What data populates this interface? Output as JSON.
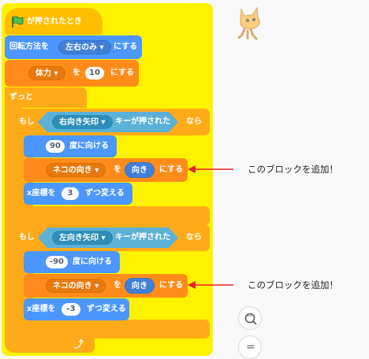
{
  "hat": {
    "label": "が押されたとき"
  },
  "rotation": {
    "prefix": "回転方法を",
    "value": "左右のみ",
    "suffix": "にする"
  },
  "health": {
    "var_name": "体力",
    "to": "を",
    "value": "10",
    "suffix": "にする"
  },
  "forever": {
    "label": "ずっと"
  },
  "if1": {
    "if_label": "もし",
    "key": "右向き矢印",
    "pressed": "キーが押された",
    "then_label": "なら",
    "point_value": "90",
    "point_suffix": "度に向ける",
    "set_var": "ネコの向き",
    "set_to": "を",
    "set_value": "向き",
    "set_suffix": "にする",
    "change_prefix": "x座標を",
    "change_value": "3",
    "change_suffix": "ずつ変える"
  },
  "if2": {
    "if_label": "もし",
    "key": "左向き矢印",
    "pressed": "キーが押された",
    "then_label": "なら",
    "point_value": "-90",
    "point_suffix": "度に向ける",
    "set_var": "ネコの向き",
    "set_to": "を",
    "set_value": "向き",
    "set_suffix": "にする",
    "change_prefix": "x座標を",
    "change_value": "-3",
    "change_suffix": "ずつ変える"
  },
  "annotations": {
    "note1": "このブロックを追加！",
    "note2": "このブロックを追加！"
  },
  "zoom": {
    "out_symbol": "−",
    "reset_symbol": "="
  },
  "colors": {
    "events": "#ffbf00",
    "motion": "#4c97ff",
    "control": "#ffab19",
    "sensing": "#5cb1d6",
    "variables": "#ff8c1a",
    "highlight": "#fff200",
    "arrow": "#e8202a"
  }
}
